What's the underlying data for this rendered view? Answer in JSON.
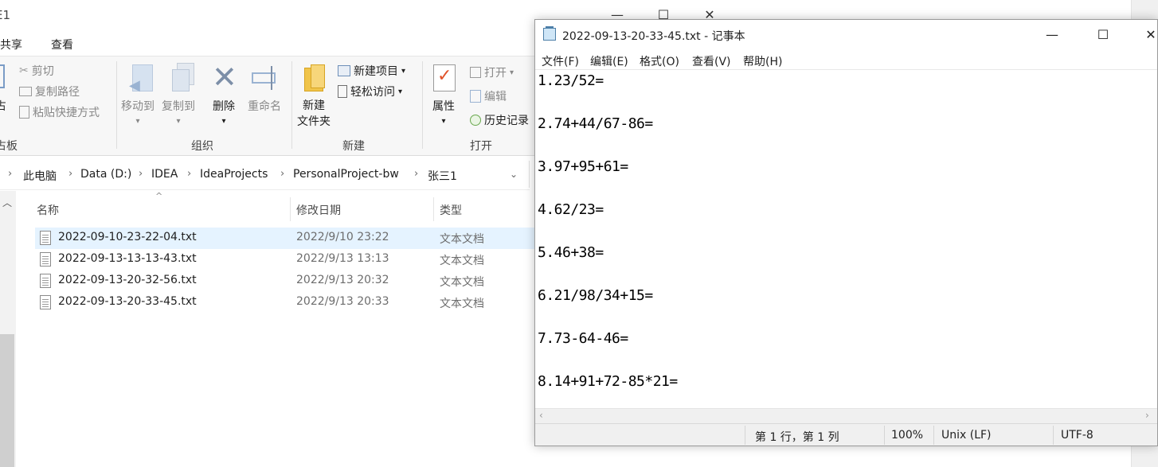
{
  "explorer": {
    "title_fragment": "E1",
    "ribbon_tabs": [
      "共享",
      "查看"
    ],
    "clipboard": {
      "paste_fragment": "占",
      "group_fragment": "占板",
      "cut": "剪切",
      "copy_path": "复制路径",
      "paste_shortcut": "粘贴快捷方式"
    },
    "organize": {
      "move_to": "移动到",
      "copy_to": "复制到",
      "delete": "删除",
      "rename": "重命名",
      "group": "组织"
    },
    "new": {
      "new_folder_line1": "新建",
      "new_folder_line2": "文件夹",
      "new_item": "新建项目",
      "easy_access": "轻松访问",
      "group": "新建"
    },
    "open": {
      "properties": "属性",
      "open": "打开",
      "edit": "编辑",
      "history": "历史记录",
      "group": "打开"
    },
    "breadcrumb": [
      "此电脑",
      "Data (D:)",
      "IDEA",
      "IdeaProjects",
      "PersonalProject-bw",
      "张三1"
    ],
    "columns": {
      "name": "名称",
      "date": "修改日期",
      "type": "类型"
    },
    "files": [
      {
        "name": "2022-09-10-23-22-04.txt",
        "date": "2022/9/10 23:22",
        "type": "文本文档",
        "selected": true
      },
      {
        "name": "2022-09-13-13-13-43.txt",
        "date": "2022/9/13 13:13",
        "type": "文本文档",
        "selected": false
      },
      {
        "name": "2022-09-13-20-32-56.txt",
        "date": "2022/9/13 20:32",
        "type": "文本文档",
        "selected": false
      },
      {
        "name": "2022-09-13-20-33-45.txt",
        "date": "2022/9/13 20:33",
        "type": "文本文档",
        "selected": false
      }
    ]
  },
  "notepad": {
    "title": "2022-09-13-20-33-45.txt - 记事本",
    "menu": [
      "文件(F)",
      "编辑(E)",
      "格式(O)",
      "查看(V)",
      "帮助(H)"
    ],
    "lines": [
      "1.23/52=",
      "2.74+44/67-86=",
      "3.97+95+61=",
      "4.62/23=",
      "5.46+38=",
      "6.21/98/34+15=",
      "7.73-64-46=",
      "8.14+91+72-85*21="
    ],
    "status": {
      "position": "第 1 行，第 1 列",
      "zoom": "100%",
      "line_ending": "Unix (LF)",
      "encoding": "UTF-8"
    }
  }
}
